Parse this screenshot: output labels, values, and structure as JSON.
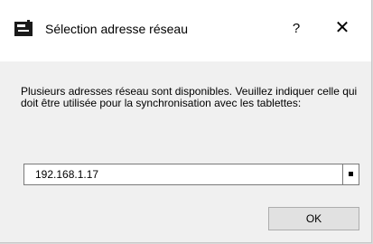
{
  "window": {
    "title": "Sélection adresse réseau",
    "help_label": "?",
    "close_label": "✕",
    "icon": "app-logo-icon"
  },
  "message": "Plusieurs adresses réseau sont disponibles. Veuillez indiquer celle qui doit être utilisée pour la synchronisation avec les tablettes:",
  "address_select": {
    "value": "192.168.1.17"
  },
  "ok_label": "OK"
}
